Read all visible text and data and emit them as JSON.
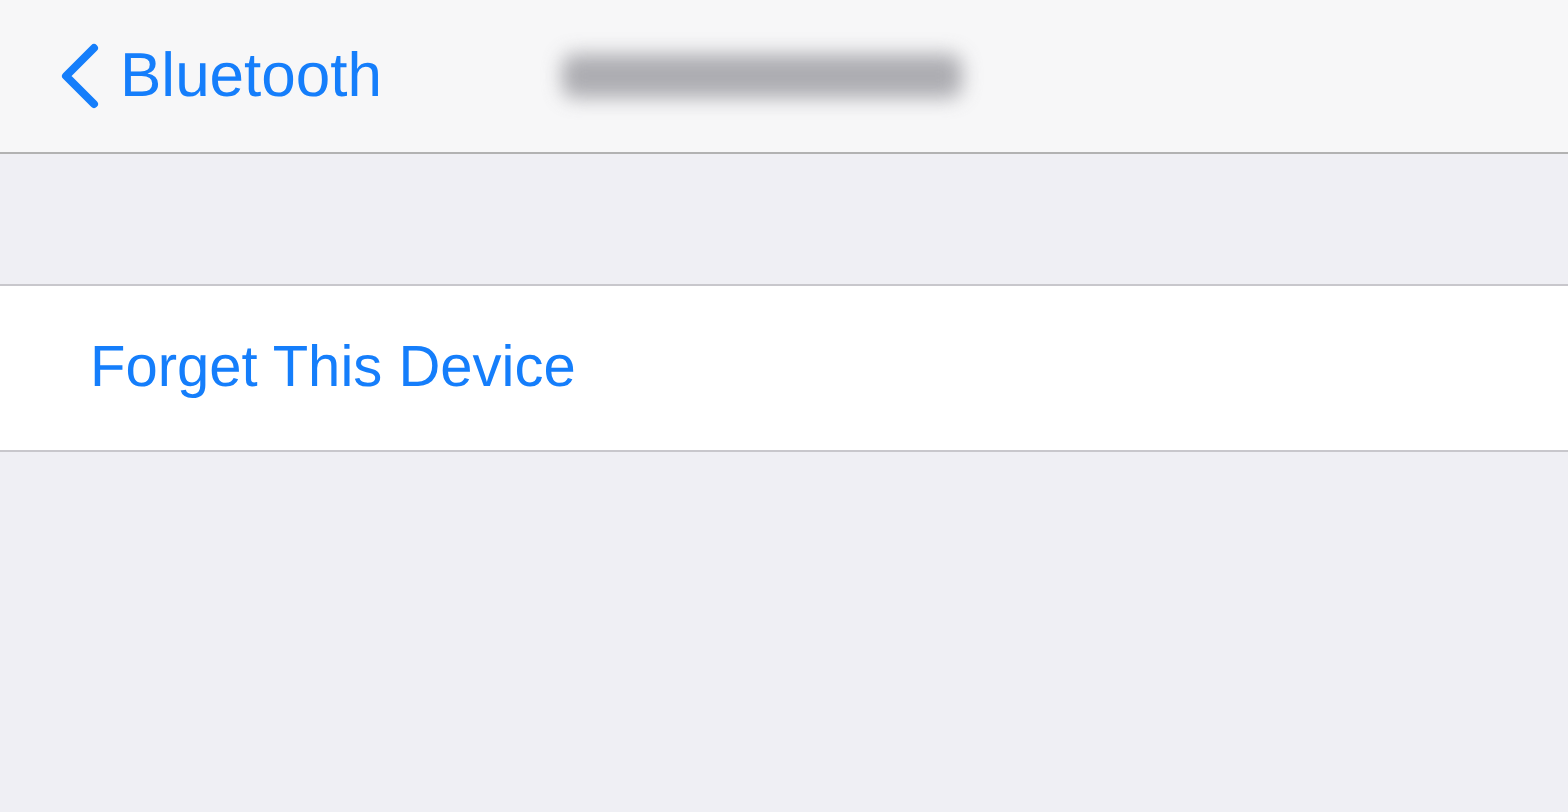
{
  "nav_bar": {
    "back_label": "Bluetooth"
  },
  "actions": [
    {
      "label": "Forget This Device"
    }
  ]
}
